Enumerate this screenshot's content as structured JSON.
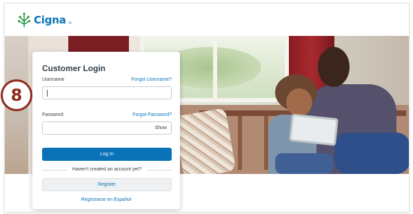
{
  "brand": {
    "name": "Cigna",
    "reg_mark": "®",
    "color": "#0a73b8"
  },
  "login": {
    "title": "Customer Login",
    "username_label": "Username",
    "forgot_username": "Forgot Username?",
    "username_value": "",
    "password_label": "Password",
    "forgot_password": "Forgot Password?",
    "password_value": "",
    "show_label": "Show",
    "login_button": "Log In",
    "no_account_text": "Haven't created an account yet?",
    "register_button": "Register",
    "spanish_link": "Registrarse en Español",
    "button_color": "#0a73b8"
  },
  "step_badge": {
    "number": "8",
    "color": "#8c2a1c"
  },
  "hero": {
    "icon": "family-photo"
  }
}
